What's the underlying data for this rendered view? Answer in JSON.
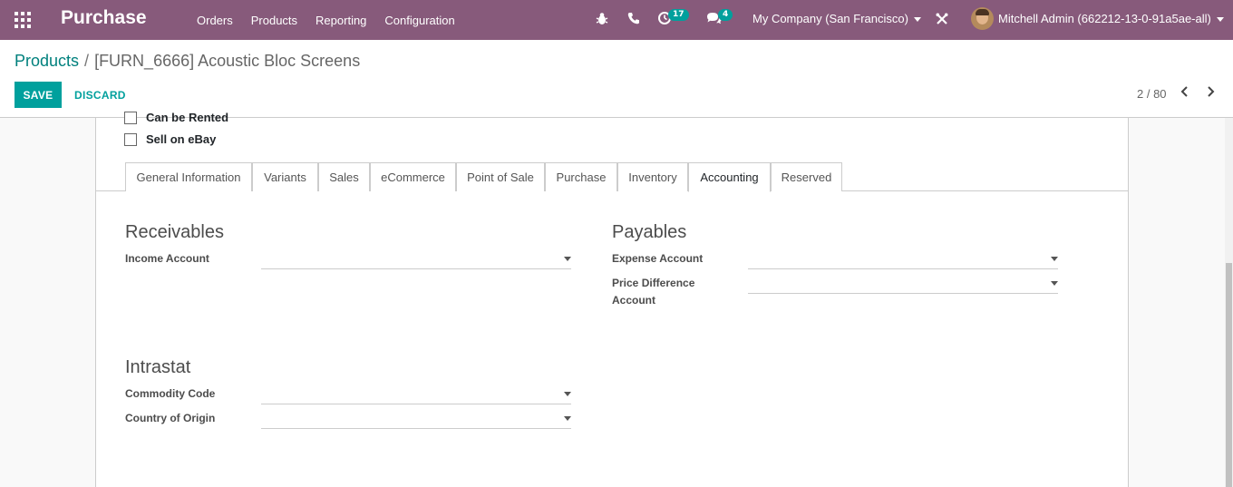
{
  "navbar": {
    "app_title": "Purchase",
    "menu": [
      "Orders",
      "Products",
      "Reporting",
      "Configuration"
    ],
    "activity_badge": "17",
    "messages_badge": "4",
    "company": "My Company (San Francisco)",
    "user": "Mitchell Admin (662212-13-0-91a5ae-all)",
    "icons": [
      "apps-icon",
      "bug-icon",
      "phone-icon",
      "clock-icon",
      "chat-icon",
      "tools-icon"
    ]
  },
  "control_panel": {
    "breadcrumb_parent": "Products",
    "breadcrumb_current": "[FURN_6666] Acoustic Bloc Screens",
    "save_label": "SAVE",
    "discard_label": "DISCARD",
    "pager": "2 / 80"
  },
  "form": {
    "checkboxes": [
      {
        "label": "Can be Rented",
        "checked": false
      },
      {
        "label": "Sell on eBay",
        "checked": false
      }
    ],
    "tabs": [
      "General Information",
      "Variants",
      "Sales",
      "eCommerce",
      "Point of Sale",
      "Purchase",
      "Inventory",
      "Accounting",
      "Reserved"
    ],
    "active_tab": "Accounting",
    "receivables": {
      "title": "Receivables",
      "income_account_label": "Income Account",
      "income_account_value": ""
    },
    "payables": {
      "title": "Payables",
      "expense_account_label": "Expense Account",
      "expense_account_value": "",
      "price_difference_label_1": "Price Difference",
      "price_difference_label_2": "Account",
      "price_difference_value": ""
    },
    "intrastat": {
      "title": "Intrastat",
      "commodity_code_label": "Commodity Code",
      "commodity_code_value": "",
      "country_of_origin_label": "Country of Origin",
      "country_of_origin_value": ""
    }
  },
  "colors": {
    "navbar": "#875a7b",
    "accent": "#00a09d",
    "badge": "#00a09d"
  }
}
